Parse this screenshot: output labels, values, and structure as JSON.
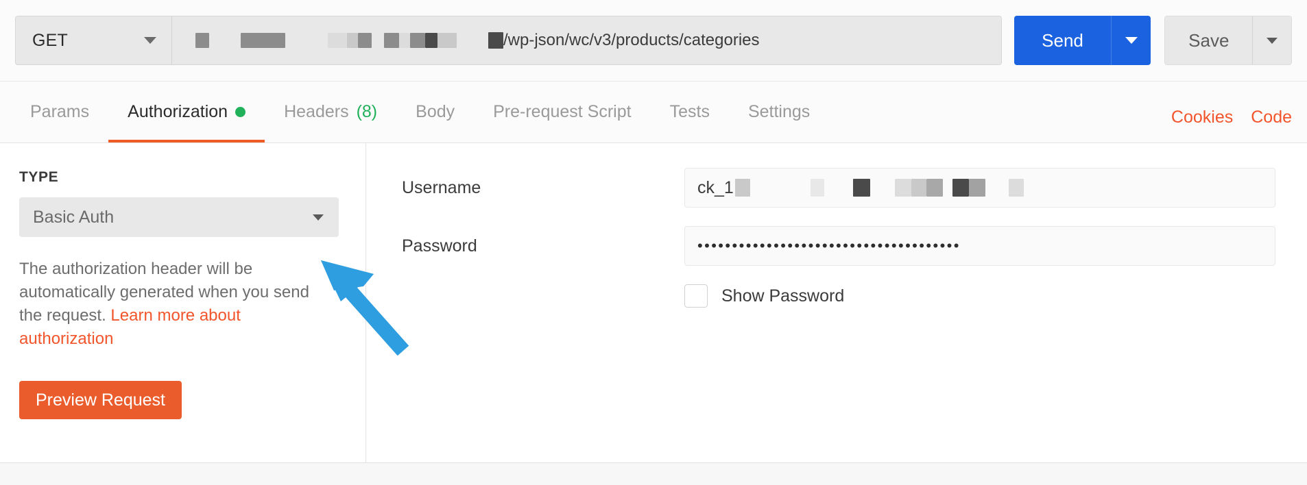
{
  "request_bar": {
    "method": "GET",
    "method_caret_icon": "chevron-down-icon",
    "url_visible_text": "/wp-json/wc/v3/products/categories",
    "url_redacted": true,
    "send_label": "Send",
    "send_caret_icon": "chevron-down-icon",
    "save_label": "Save",
    "save_caret_icon": "chevron-down-icon",
    "send_color": "#1a62e0"
  },
  "tabs": [
    {
      "label": "Params",
      "active": false,
      "indicator": "",
      "count": ""
    },
    {
      "label": "Authorization",
      "active": true,
      "indicator": "green-dot",
      "count": ""
    },
    {
      "label": "Headers",
      "active": false,
      "indicator": "",
      "count": "(8)"
    },
    {
      "label": "Body",
      "active": false,
      "indicator": "",
      "count": ""
    },
    {
      "label": "Pre-request Script",
      "active": false,
      "indicator": "",
      "count": ""
    },
    {
      "label": "Tests",
      "active": false,
      "indicator": "",
      "count": ""
    },
    {
      "label": "Settings",
      "active": false,
      "indicator": "",
      "count": ""
    }
  ],
  "tab_actions": {
    "cookies_label": "Cookies",
    "code_label": "Code",
    "link_color": "#f2552c"
  },
  "auth_panel": {
    "type_heading": "TYPE",
    "type_value": "Basic Auth",
    "type_caret_icon": "chevron-down-icon",
    "help_text_before": "The authorization header will be automatically generated when you send the request. ",
    "help_link_text": "Learn more about authorization",
    "preview_button_label": "Preview Request",
    "preview_button_color": "#eb5c2d"
  },
  "credentials": {
    "username_label": "Username",
    "username_value_prefix": "ck_1",
    "username_redacted": true,
    "password_label": "Password",
    "password_masked_value": "••••••••••••••••••••••••••••••••••••••",
    "show_password_label": "Show Password",
    "show_password_checked": false
  },
  "annotation": {
    "arrow_color": "#2e9ee0",
    "arrow_points_to": "auth-type-select"
  }
}
